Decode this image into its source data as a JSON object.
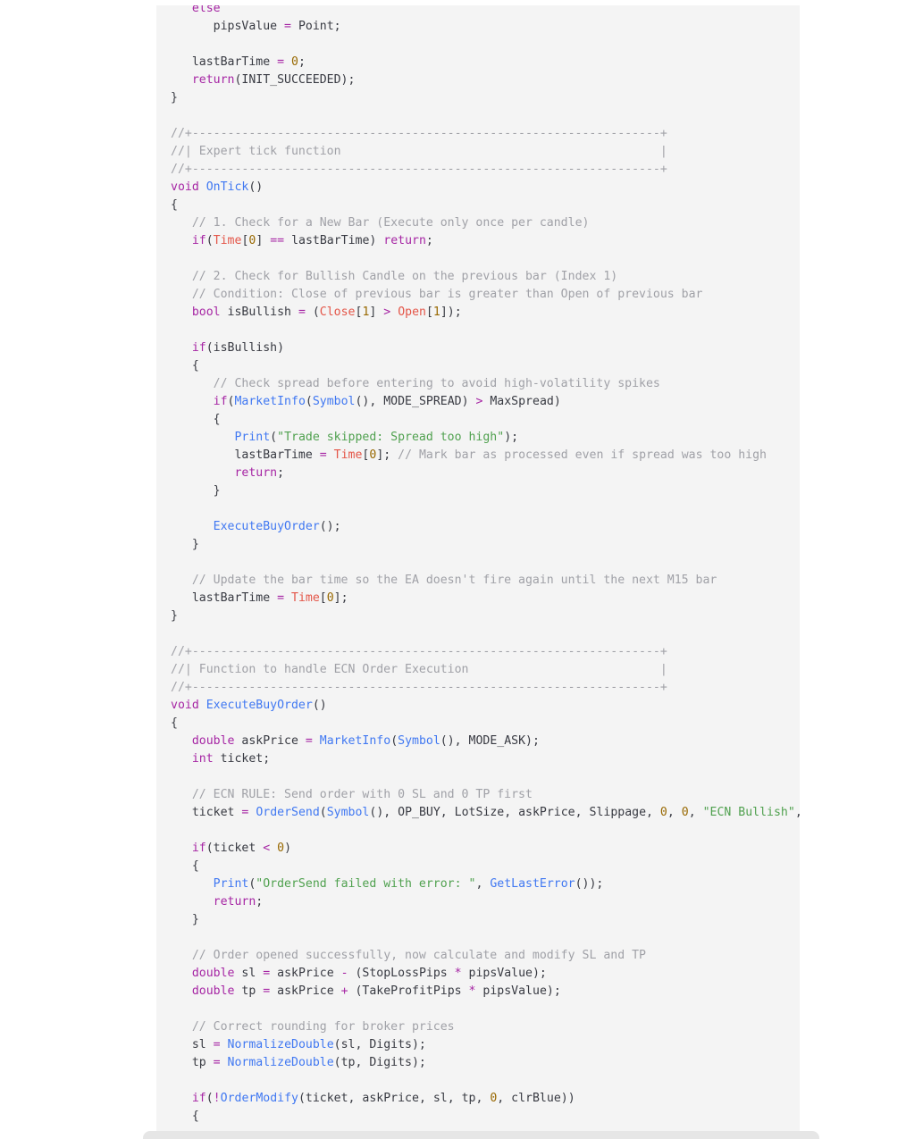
{
  "colors": {
    "keyword": "#a626a4",
    "function": "#4078f2",
    "comment": "#a0a1a7",
    "string": "#50a14f",
    "number": "#986801",
    "array": "#e45649",
    "plain": "#383a42",
    "background": "#f4f4f4"
  },
  "code_lines": [
    [
      [
        "   ",
        "pl"
      ],
      [
        "else",
        "kw"
      ]
    ],
    [
      [
        "      pipsValue ",
        "pl"
      ],
      [
        "=",
        "op"
      ],
      [
        " Point;",
        "pl"
      ]
    ],
    [],
    [
      [
        "   lastBarTime ",
        "pl"
      ],
      [
        "=",
        "op"
      ],
      [
        " ",
        "pl"
      ],
      [
        "0",
        "num"
      ],
      [
        ";",
        "pl"
      ]
    ],
    [
      [
        "   ",
        "pl"
      ],
      [
        "return",
        "kw"
      ],
      [
        "(INIT_SUCCEEDED);",
        "pl"
      ]
    ],
    [
      [
        "}",
        "pl"
      ]
    ],
    [],
    [
      [
        "//+------------------------------------------------------------------+",
        "cm"
      ]
    ],
    [
      [
        "//| Expert tick function                                             |",
        "cm"
      ]
    ],
    [
      [
        "//+------------------------------------------------------------------+",
        "cm"
      ]
    ],
    [
      [
        "void",
        "kw"
      ],
      [
        " ",
        "pl"
      ],
      [
        "OnTick",
        "fn"
      ],
      [
        "()",
        "pl"
      ]
    ],
    [
      [
        "{",
        "pl"
      ]
    ],
    [
      [
        "   ",
        "pl"
      ],
      [
        "// 1. Check for a New Bar (Execute only once per candle)",
        "cm"
      ]
    ],
    [
      [
        "   ",
        "pl"
      ],
      [
        "if",
        "kw"
      ],
      [
        "(",
        "pl"
      ],
      [
        "Time",
        "arr"
      ],
      [
        "[",
        "pl"
      ],
      [
        "0",
        "num"
      ],
      [
        "] ",
        "pl"
      ],
      [
        "==",
        "op"
      ],
      [
        " lastBarTime) ",
        "pl"
      ],
      [
        "return",
        "kw"
      ],
      [
        ";",
        "pl"
      ]
    ],
    [],
    [
      [
        "   ",
        "pl"
      ],
      [
        "// 2. Check for Bullish Candle on the previous bar (Index 1)",
        "cm"
      ]
    ],
    [
      [
        "   ",
        "pl"
      ],
      [
        "// Condition: Close of previous bar is greater than Open of previous bar",
        "cm"
      ]
    ],
    [
      [
        "   ",
        "pl"
      ],
      [
        "bool",
        "kw"
      ],
      [
        " isBullish ",
        "pl"
      ],
      [
        "=",
        "op"
      ],
      [
        " (",
        "pl"
      ],
      [
        "Close",
        "arr"
      ],
      [
        "[",
        "pl"
      ],
      [
        "1",
        "num"
      ],
      [
        "] ",
        "pl"
      ],
      [
        ">",
        "op"
      ],
      [
        " ",
        "pl"
      ],
      [
        "Open",
        "arr"
      ],
      [
        "[",
        "pl"
      ],
      [
        "1",
        "num"
      ],
      [
        "]);",
        "pl"
      ]
    ],
    [],
    [
      [
        "   ",
        "pl"
      ],
      [
        "if",
        "kw"
      ],
      [
        "(isBullish)",
        "pl"
      ]
    ],
    [
      [
        "   {",
        "pl"
      ]
    ],
    [
      [
        "      ",
        "pl"
      ],
      [
        "// Check spread before entering to avoid high-volatility spikes",
        "cm"
      ]
    ],
    [
      [
        "      ",
        "pl"
      ],
      [
        "if",
        "kw"
      ],
      [
        "(",
        "pl"
      ],
      [
        "MarketInfo",
        "fn"
      ],
      [
        "(",
        "pl"
      ],
      [
        "Symbol",
        "fn"
      ],
      [
        "(), MODE_SPREAD) ",
        "pl"
      ],
      [
        ">",
        "op"
      ],
      [
        " MaxSpread)",
        "pl"
      ]
    ],
    [
      [
        "      {",
        "pl"
      ]
    ],
    [
      [
        "         ",
        "pl"
      ],
      [
        "Print",
        "fn"
      ],
      [
        "(",
        "pl"
      ],
      [
        "\"Trade skipped: Spread too high\"",
        "st"
      ],
      [
        ");",
        "pl"
      ]
    ],
    [
      [
        "         lastBarTime ",
        "pl"
      ],
      [
        "=",
        "op"
      ],
      [
        " ",
        "pl"
      ],
      [
        "Time",
        "arr"
      ],
      [
        "[",
        "pl"
      ],
      [
        "0",
        "num"
      ],
      [
        "]; ",
        "pl"
      ],
      [
        "// Mark bar as processed even if spread was too high",
        "cm"
      ]
    ],
    [
      [
        "         ",
        "pl"
      ],
      [
        "return",
        "kw"
      ],
      [
        ";",
        "pl"
      ]
    ],
    [
      [
        "      }",
        "pl"
      ]
    ],
    [],
    [
      [
        "      ",
        "pl"
      ],
      [
        "ExecuteBuyOrder",
        "fn"
      ],
      [
        "();",
        "pl"
      ]
    ],
    [
      [
        "   }",
        "pl"
      ]
    ],
    [],
    [
      [
        "   ",
        "pl"
      ],
      [
        "// Update the bar time so the EA doesn't fire again until the next M15 bar",
        "cm"
      ]
    ],
    [
      [
        "   lastBarTime ",
        "pl"
      ],
      [
        "=",
        "op"
      ],
      [
        " ",
        "pl"
      ],
      [
        "Time",
        "arr"
      ],
      [
        "[",
        "pl"
      ],
      [
        "0",
        "num"
      ],
      [
        "];",
        "pl"
      ]
    ],
    [
      [
        "}",
        "pl"
      ]
    ],
    [],
    [
      [
        "//+------------------------------------------------------------------+",
        "cm"
      ]
    ],
    [
      [
        "//| Function to handle ECN Order Execution                           |",
        "cm"
      ]
    ],
    [
      [
        "//+------------------------------------------------------------------+",
        "cm"
      ]
    ],
    [
      [
        "void",
        "kw"
      ],
      [
        " ",
        "pl"
      ],
      [
        "ExecuteBuyOrder",
        "fn"
      ],
      [
        "()",
        "pl"
      ]
    ],
    [
      [
        "{",
        "pl"
      ]
    ],
    [
      [
        "   ",
        "pl"
      ],
      [
        "double",
        "kw"
      ],
      [
        " askPrice ",
        "pl"
      ],
      [
        "=",
        "op"
      ],
      [
        " ",
        "pl"
      ],
      [
        "MarketInfo",
        "fn"
      ],
      [
        "(",
        "pl"
      ],
      [
        "Symbol",
        "fn"
      ],
      [
        "(), MODE_ASK);",
        "pl"
      ]
    ],
    [
      [
        "   ",
        "pl"
      ],
      [
        "int",
        "kw"
      ],
      [
        " ticket;",
        "pl"
      ]
    ],
    [],
    [
      [
        "   ",
        "pl"
      ],
      [
        "// ECN RULE: Send order with 0 SL and 0 TP first",
        "cm"
      ]
    ],
    [
      [
        "   ticket ",
        "pl"
      ],
      [
        "=",
        "op"
      ],
      [
        " ",
        "pl"
      ],
      [
        "OrderSend",
        "fn"
      ],
      [
        "(",
        "pl"
      ],
      [
        "Symbol",
        "fn"
      ],
      [
        "(), OP_BUY, LotSize, askPrice, Slippage, ",
        "pl"
      ],
      [
        "0",
        "num"
      ],
      [
        ", ",
        "pl"
      ],
      [
        "0",
        "num"
      ],
      [
        ", ",
        "pl"
      ],
      [
        "\"ECN Bullish\"",
        "st"
      ],
      [
        ", Ma",
        "pl"
      ]
    ],
    [],
    [
      [
        "   ",
        "pl"
      ],
      [
        "if",
        "kw"
      ],
      [
        "(ticket ",
        "pl"
      ],
      [
        "<",
        "op"
      ],
      [
        " ",
        "pl"
      ],
      [
        "0",
        "num"
      ],
      [
        ")",
        "pl"
      ]
    ],
    [
      [
        "   {",
        "pl"
      ]
    ],
    [
      [
        "      ",
        "pl"
      ],
      [
        "Print",
        "fn"
      ],
      [
        "(",
        "pl"
      ],
      [
        "\"OrderSend failed with error: \"",
        "st"
      ],
      [
        ", ",
        "pl"
      ],
      [
        "GetLastError",
        "fn"
      ],
      [
        "());",
        "pl"
      ]
    ],
    [
      [
        "      ",
        "pl"
      ],
      [
        "return",
        "kw"
      ],
      [
        ";",
        "pl"
      ]
    ],
    [
      [
        "   }",
        "pl"
      ]
    ],
    [],
    [
      [
        "   ",
        "pl"
      ],
      [
        "// Order opened successfully, now calculate and modify SL and TP",
        "cm"
      ]
    ],
    [
      [
        "   ",
        "pl"
      ],
      [
        "double",
        "kw"
      ],
      [
        " sl ",
        "pl"
      ],
      [
        "=",
        "op"
      ],
      [
        " askPrice ",
        "pl"
      ],
      [
        "-",
        "op"
      ],
      [
        " (StopLossPips ",
        "pl"
      ],
      [
        "*",
        "op"
      ],
      [
        " pipsValue);",
        "pl"
      ]
    ],
    [
      [
        "   ",
        "pl"
      ],
      [
        "double",
        "kw"
      ],
      [
        " tp ",
        "pl"
      ],
      [
        "=",
        "op"
      ],
      [
        " askPrice ",
        "pl"
      ],
      [
        "+",
        "op"
      ],
      [
        " (TakeProfitPips ",
        "pl"
      ],
      [
        "*",
        "op"
      ],
      [
        " pipsValue);",
        "pl"
      ]
    ],
    [],
    [
      [
        "   ",
        "pl"
      ],
      [
        "// Correct rounding for broker prices",
        "cm"
      ]
    ],
    [
      [
        "   sl ",
        "pl"
      ],
      [
        "=",
        "op"
      ],
      [
        " ",
        "pl"
      ],
      [
        "NormalizeDouble",
        "fn"
      ],
      [
        "(sl, Digits);",
        "pl"
      ]
    ],
    [
      [
        "   tp ",
        "pl"
      ],
      [
        "=",
        "op"
      ],
      [
        " ",
        "pl"
      ],
      [
        "NormalizeDouble",
        "fn"
      ],
      [
        "(tp, Digits);",
        "pl"
      ]
    ],
    [],
    [
      [
        "   ",
        "pl"
      ],
      [
        "if",
        "kw"
      ],
      [
        "(",
        "pl"
      ],
      [
        "!",
        "op"
      ],
      [
        "OrderModify",
        "fn"
      ],
      [
        "(ticket, askPrice, sl, tp, ",
        "pl"
      ],
      [
        "0",
        "num"
      ],
      [
        ", clrBlue))",
        "pl"
      ]
    ],
    [
      [
        "   {",
        "pl"
      ]
    ]
  ]
}
